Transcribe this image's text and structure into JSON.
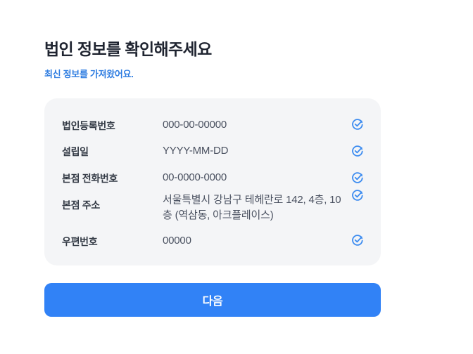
{
  "header": {
    "title": "법인 정보를 확인해주세요",
    "subtitle": "최신 정보를 가져왔어요."
  },
  "info": {
    "rows": [
      {
        "label": "법인등록번호",
        "value": "000-00-00000",
        "icon": "check-circle-icon"
      },
      {
        "label": "설립일",
        "value": "YYYY-MM-DD",
        "icon": "check-circle-icon"
      },
      {
        "label": "본점 전화번호",
        "value": "00-0000-0000",
        "icon": "check-circle-icon"
      },
      {
        "label": "본점 주소",
        "value": "서울특별시 강남구 테헤란로 142, 4층, 10층 (역삼동, 아크플레이스)",
        "icon": "check-circle-icon"
      },
      {
        "label": "우편번호",
        "value": "00000",
        "icon": "check-circle-icon"
      }
    ]
  },
  "footer": {
    "next_label": "다음"
  },
  "colors": {
    "accent": "#3182f6",
    "card_background": "#f4f5f7",
    "check": "#3b8bf0"
  }
}
